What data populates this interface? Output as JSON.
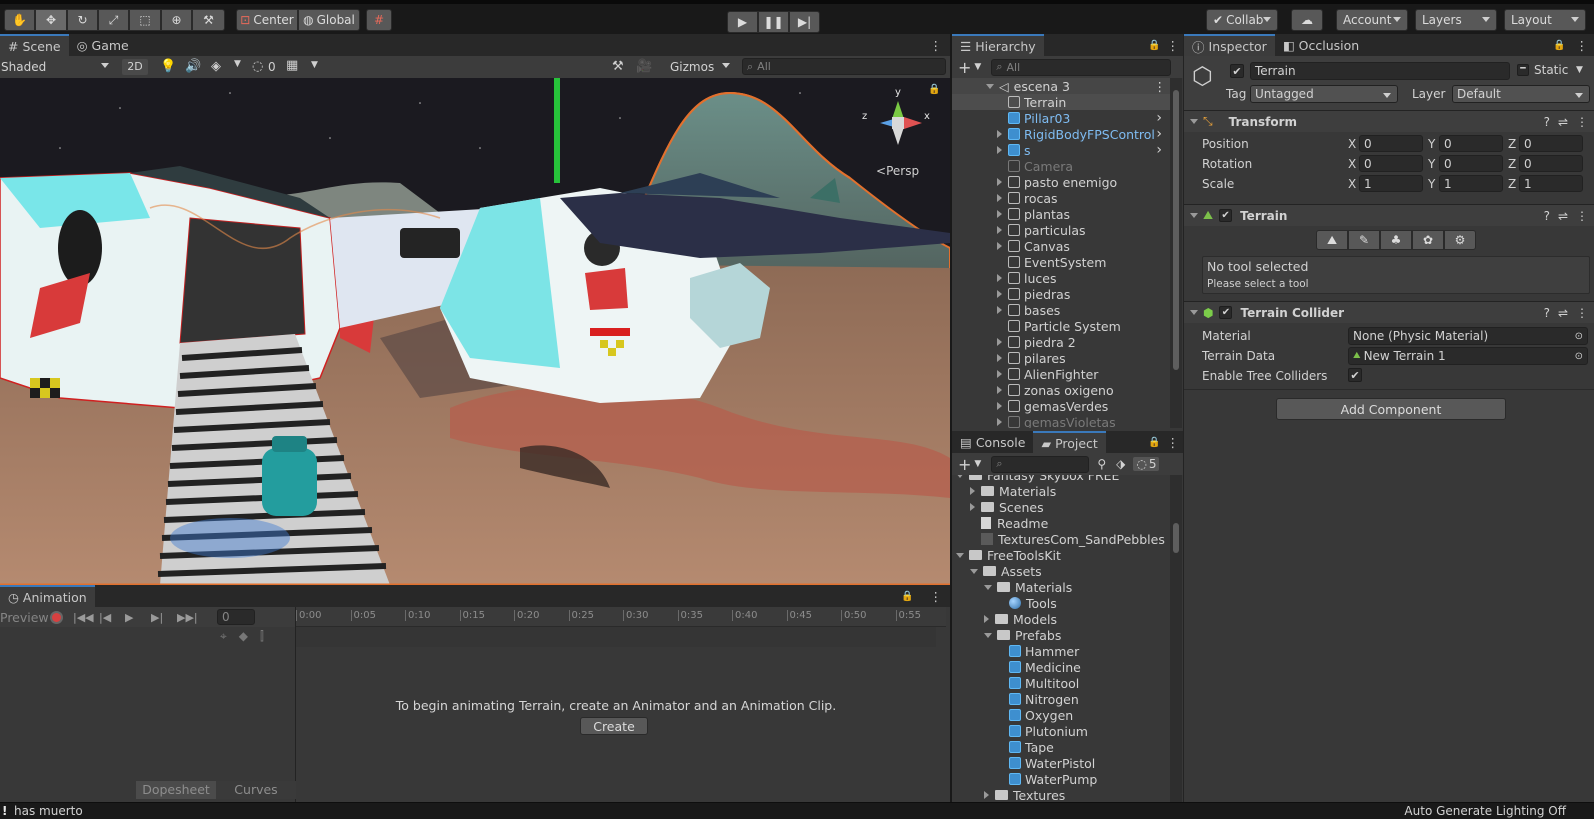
{
  "toolbar": {
    "pivot_label": "Center",
    "space_label": "Global",
    "collab_label": "Collab",
    "account_label": "Account",
    "layers_label": "Layers",
    "layout_label": "Layout"
  },
  "scene_view": {
    "tabs": [
      "Scene",
      "Game"
    ],
    "shading_mode": "Shaded",
    "mode_2d": "2D",
    "hidden_count": "0",
    "gizmos_label": "Gizmos",
    "search_placeholder": "All",
    "persp_label": "Persp",
    "axis_labels": {
      "y": "y",
      "x": "x",
      "z": "z"
    }
  },
  "hierarchy": {
    "title": "Hierarchy",
    "search_placeholder": "All",
    "scene_name": "escena 3",
    "items": [
      {
        "label": "Terrain",
        "kind": "object",
        "expand": false,
        "selected": true
      },
      {
        "label": "Pillar03",
        "kind": "prefab",
        "expand": false,
        "child_arrow": true
      },
      {
        "label": "RigidBodyFPSControl",
        "kind": "prefab",
        "expand": true,
        "child_arrow": true
      },
      {
        "label": "s",
        "kind": "prefab",
        "expand": true,
        "child_arrow": true
      },
      {
        "label": "Camera",
        "kind": "disabled",
        "expand": false
      },
      {
        "label": "pasto enemigo",
        "kind": "object",
        "expand": true
      },
      {
        "label": "rocas",
        "kind": "object",
        "expand": true
      },
      {
        "label": "plantas",
        "kind": "object",
        "expand": true
      },
      {
        "label": "particulas",
        "kind": "object",
        "expand": true
      },
      {
        "label": "Canvas",
        "kind": "object",
        "expand": true
      },
      {
        "label": "EventSystem",
        "kind": "object",
        "expand": false
      },
      {
        "label": "luces",
        "kind": "object",
        "expand": true
      },
      {
        "label": "piedras",
        "kind": "object",
        "expand": true
      },
      {
        "label": "bases",
        "kind": "object",
        "expand": true
      },
      {
        "label": "Particle System",
        "kind": "object",
        "expand": false
      },
      {
        "label": "piedra 2",
        "kind": "object",
        "expand": true
      },
      {
        "label": "pilares",
        "kind": "object",
        "expand": true
      },
      {
        "label": "AlienFighter",
        "kind": "object",
        "expand": true
      },
      {
        "label": "zonas oxigeno",
        "kind": "object",
        "expand": true
      },
      {
        "label": "gemasVerdes",
        "kind": "object",
        "expand": true
      },
      {
        "label": "gemasVioletas",
        "kind": "disabled",
        "expand": true
      }
    ]
  },
  "project": {
    "tabs": [
      "Console",
      "Project"
    ],
    "hidden_count": "5",
    "items": [
      {
        "label": "Fantasy Skybox FREE",
        "depth": 1,
        "icon": "folder",
        "arrow": "down"
      },
      {
        "label": "Materials",
        "depth": 2,
        "icon": "folder",
        "arrow": "right"
      },
      {
        "label": "Scenes",
        "depth": 2,
        "icon": "folder",
        "arrow": "right"
      },
      {
        "label": "Readme",
        "depth": 2,
        "icon": "doc",
        "arrow": "none"
      },
      {
        "label": "TexturesCom_SandPebbles",
        "depth": 2,
        "icon": "texture",
        "arrow": "none"
      },
      {
        "label": "FreeToolsKit",
        "depth": 1,
        "icon": "folder",
        "arrow": "down"
      },
      {
        "label": "Assets",
        "depth": 2,
        "icon": "folder",
        "arrow": "down"
      },
      {
        "label": "Materials",
        "depth": 3,
        "icon": "folder",
        "arrow": "down"
      },
      {
        "label": "Tools",
        "depth": 4,
        "icon": "material",
        "arrow": "none"
      },
      {
        "label": "Models",
        "depth": 3,
        "icon": "folder",
        "arrow": "right"
      },
      {
        "label": "Prefabs",
        "depth": 3,
        "icon": "folder",
        "arrow": "down"
      },
      {
        "label": "Hammer",
        "depth": 4,
        "icon": "prefab",
        "arrow": "none"
      },
      {
        "label": "Medicine",
        "depth": 4,
        "icon": "prefab",
        "arrow": "none"
      },
      {
        "label": "Multitool",
        "depth": 4,
        "icon": "prefab",
        "arrow": "none"
      },
      {
        "label": "Nitrogen",
        "depth": 4,
        "icon": "prefab",
        "arrow": "none"
      },
      {
        "label": "Oxygen",
        "depth": 4,
        "icon": "prefab",
        "arrow": "none"
      },
      {
        "label": "Plutonium",
        "depth": 4,
        "icon": "prefab",
        "arrow": "none"
      },
      {
        "label": "Tape",
        "depth": 4,
        "icon": "prefab",
        "arrow": "none"
      },
      {
        "label": "WaterPistol",
        "depth": 4,
        "icon": "prefab",
        "arrow": "none"
      },
      {
        "label": "WaterPump",
        "depth": 4,
        "icon": "prefab",
        "arrow": "none"
      },
      {
        "label": "Textures",
        "depth": 3,
        "icon": "folder",
        "arrow": "right"
      }
    ]
  },
  "inspector": {
    "tabs": [
      "Inspector",
      "Occlusion"
    ],
    "object_name": "Terrain",
    "static_label": "Static",
    "tag_label": "Tag",
    "tag_value": "Untagged",
    "layer_label": "Layer",
    "layer_value": "Default",
    "transform": {
      "title": "Transform",
      "rows": [
        {
          "label": "Position",
          "x": "0",
          "y": "0",
          "z": "0"
        },
        {
          "label": "Rotation",
          "x": "0",
          "y": "0",
          "z": "0"
        },
        {
          "label": "Scale",
          "x": "1",
          "y": "1",
          "z": "1"
        }
      ],
      "axis": [
        "X",
        "Y",
        "Z"
      ]
    },
    "terrain": {
      "title": "Terrain",
      "status_title": "No tool selected",
      "status_sub": "Please select a tool"
    },
    "collider": {
      "title": "Terrain Collider",
      "material_label": "Material",
      "material_value": "None (Physic Material)",
      "data_label": "Terrain Data",
      "data_value": "New Terrain 1",
      "trees_label": "Enable Tree Colliders"
    },
    "add_component": "Add Component"
  },
  "animation": {
    "title": "Animation",
    "preview_label": "Preview",
    "frame_value": "0",
    "ticks": [
      "0:00",
      "0:05",
      "0:10",
      "0:15",
      "0:20",
      "0:25",
      "0:30",
      "0:35",
      "0:40",
      "0:45",
      "0:50",
      "0:55"
    ],
    "message": "To begin animating Terrain, create an Animator and an Animation Clip.",
    "create_label": "Create",
    "dopesheet_label": "Dopesheet",
    "curves_label": "Curves"
  },
  "status_bar": {
    "message": "has muerto",
    "lighting": "Auto Generate Lighting Off"
  },
  "colors": {
    "accent": "#3a79bb",
    "selection": "#2c5d87",
    "prefab_text": "#7fbcf2",
    "record": "#d64040"
  }
}
